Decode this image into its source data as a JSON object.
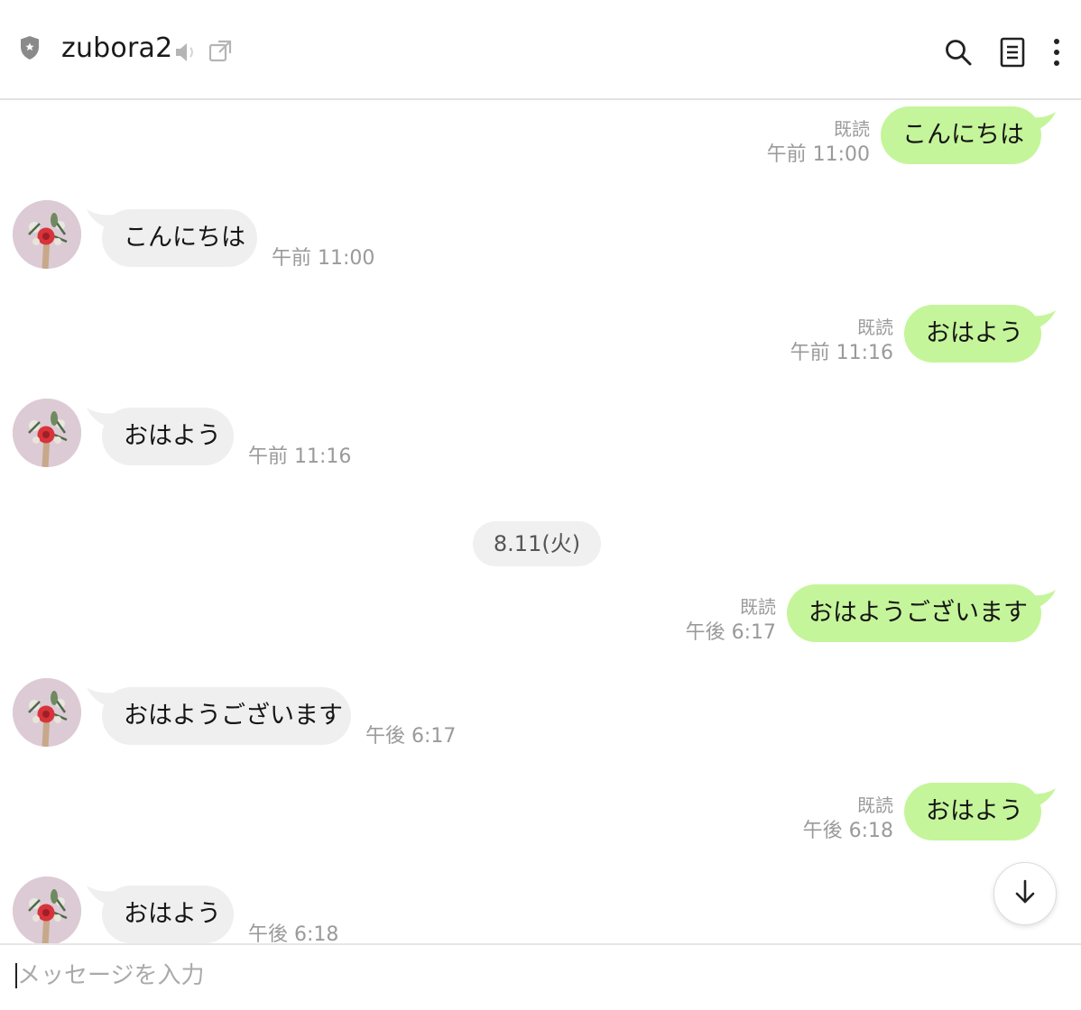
{
  "header": {
    "title": "zubora2",
    "icons": [
      "shield-icon",
      "mute-icon",
      "external-link-icon",
      "search-icon",
      "notes-icon",
      "more-icon"
    ]
  },
  "colors": {
    "sent_bubble": "#c5f59a",
    "received_bubble": "#efefef",
    "meta_text": "#9a9a9a"
  },
  "messages": [
    {
      "direction": "sent",
      "text": "こんにちは",
      "read": "既読",
      "time": "午前 11:00"
    },
    {
      "direction": "received",
      "text": "こんにちは",
      "time": "午前 11:00"
    },
    {
      "direction": "sent",
      "text": "おはよう",
      "read": "既読",
      "time": "午前 11:16"
    },
    {
      "direction": "received",
      "text": "おはよう",
      "time": "午前 11:16"
    },
    {
      "direction": "sent",
      "text": "おはようございます",
      "read": "既読",
      "time": "午後 6:17"
    },
    {
      "direction": "received",
      "text": "おはようございます",
      "time": "午後 6:17"
    },
    {
      "direction": "sent",
      "text": "おはよう",
      "read": "既読",
      "time": "午後 6:18"
    },
    {
      "direction": "received",
      "text": "おはよう",
      "time": "午後 6:18"
    }
  ],
  "date_separator": "8.11(火)",
  "composer": {
    "placeholder": "メッセージを入力",
    "value": ""
  }
}
